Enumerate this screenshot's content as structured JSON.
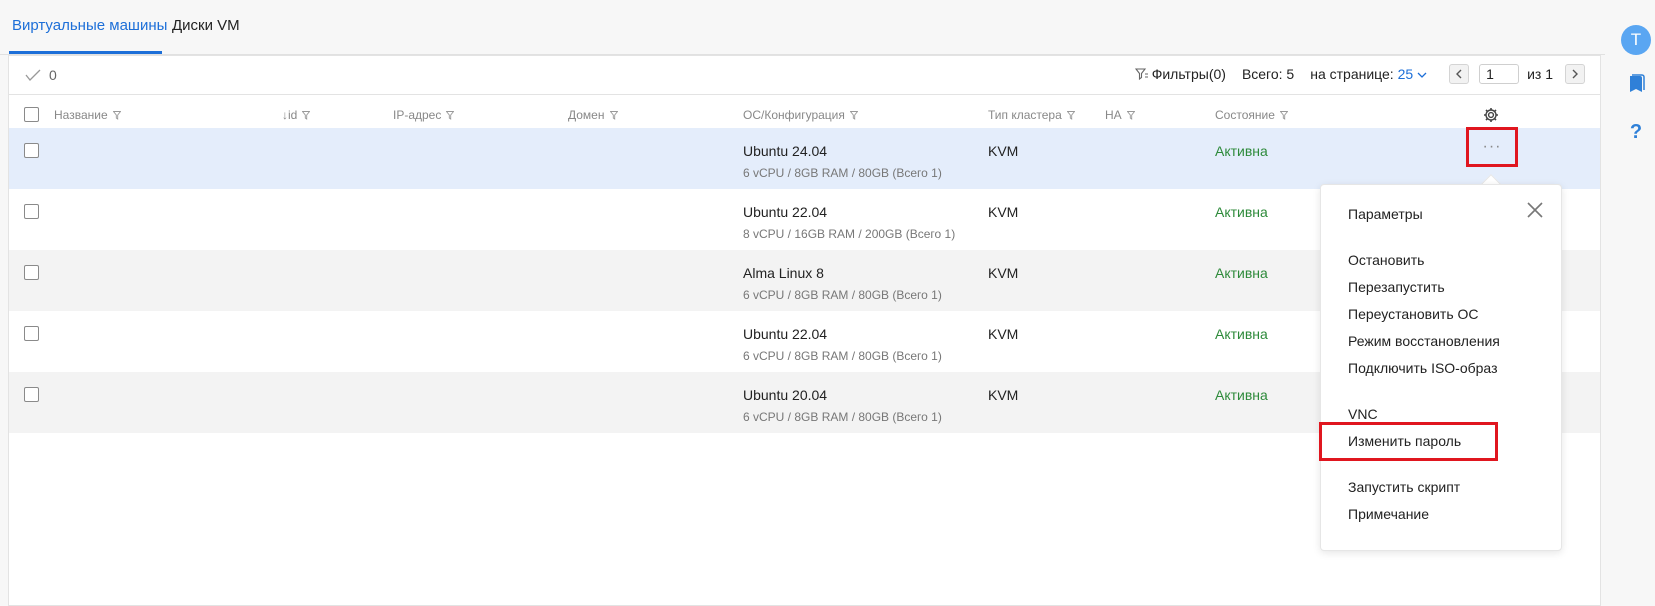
{
  "tabs": [
    {
      "label": "Виртуальные машины",
      "active": true
    },
    {
      "label": "Диски VM",
      "active": false
    }
  ],
  "rail": {
    "avatar_letter": "T"
  },
  "toolbar": {
    "selected_count": "0",
    "filters_label": "Фильтры(0)",
    "total_label": "Всего: 5",
    "per_page_label": "на странице:",
    "per_page_value": "25",
    "page_value": "1",
    "page_of_label": "из",
    "page_total": "1"
  },
  "columns": {
    "name": "Название",
    "id": "↓id",
    "ip": "IP-адрес",
    "domain": "Домен",
    "os": "ОС/Конфигурация",
    "cluster": "Тип кластера",
    "ha": "HA",
    "state": "Состояние"
  },
  "rows": [
    {
      "os": "Ubuntu 24.04",
      "config": "6 vCPU / 8GB RAM / 80GB (Всего 1)",
      "cluster": "KVM",
      "state": "Активна"
    },
    {
      "os": "Ubuntu 22.04",
      "config": "8 vCPU / 16GB RAM / 200GB (Всего 1)",
      "cluster": "KVM",
      "state": "Активна"
    },
    {
      "os": "Alma Linux 8",
      "config": "6 vCPU / 8GB RAM / 80GB (Всего 1)",
      "cluster": "KVM",
      "state": "Активна"
    },
    {
      "os": "Ubuntu 22.04",
      "config": "6 vCPU / 8GB RAM / 80GB (Всего 1)",
      "cluster": "KVM",
      "state": "Активна"
    },
    {
      "os": "Ubuntu 20.04",
      "config": "6 vCPU / 8GB RAM / 80GB (Всего 1)",
      "cluster": "KVM",
      "state": "Активна"
    }
  ],
  "row_actions_label": "···",
  "menu": {
    "items": [
      "Параметры",
      "Остановить",
      "Перезапустить",
      "Переустановить ОС",
      "Режим восстановления",
      "Подключить ISO-образ",
      "VNC",
      "Изменить пароль",
      "Запустить скрипт",
      "Примечание"
    ]
  },
  "colors": {
    "accent": "#1d6fd8",
    "active_state": "#2d8a3a",
    "highlight_box": "#e0161f",
    "selected_row": "#e4edfb"
  }
}
